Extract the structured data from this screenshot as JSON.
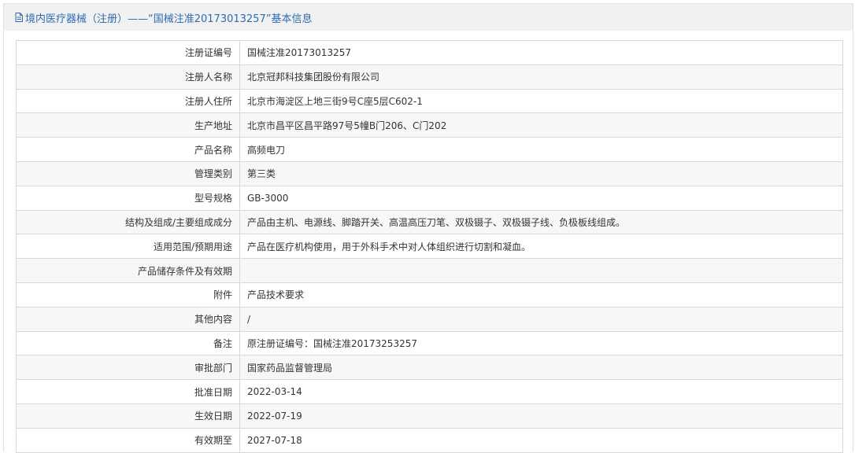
{
  "header": {
    "title": "境内医疗器械（注册）——“国械注准20173013257”基本信息",
    "icon": "document-icon",
    "color": "#2d6cb2"
  },
  "rows": [
    {
      "label": "注册证编号",
      "value": "国械注准20173013257"
    },
    {
      "label": "注册人名称",
      "value": "北京冠邦科技集团股份有限公司"
    },
    {
      "label": "注册人住所",
      "value": "北京市海淀区上地三街9号C座5层C602-1"
    },
    {
      "label": "生产地址",
      "value": "北京市昌平区昌平路97号5幢B门206、C门202"
    },
    {
      "label": "产品名称",
      "value": "高频电刀"
    },
    {
      "label": "管理类别",
      "value": "第三类"
    },
    {
      "label": "型号规格",
      "value": "GB-3000"
    },
    {
      "label": "结构及组成/主要组成成分",
      "value": "产品由主机、电源线、脚踏开关、高温高压刀笔、双极镊子、双极镊子线、负极板线组成。"
    },
    {
      "label": "适用范围/预期用途",
      "value": "产品在医疗机构使用，用于外科手术中对人体组织进行切割和凝血。"
    },
    {
      "label": "产品储存条件及有效期",
      "value": ""
    },
    {
      "label": "附件",
      "value": "产品技术要求"
    },
    {
      "label": "其他内容",
      "value": "/"
    },
    {
      "label": "备注",
      "value": "原注册证编号：国械注准20173253257"
    },
    {
      "label": "审批部门",
      "value": "国家药品监督管理局"
    },
    {
      "label": "批准日期",
      "value": "2022-03-14"
    },
    {
      "label": "生效日期",
      "value": "2022-07-19"
    },
    {
      "label": "有效期至",
      "value": "2027-07-18"
    }
  ]
}
